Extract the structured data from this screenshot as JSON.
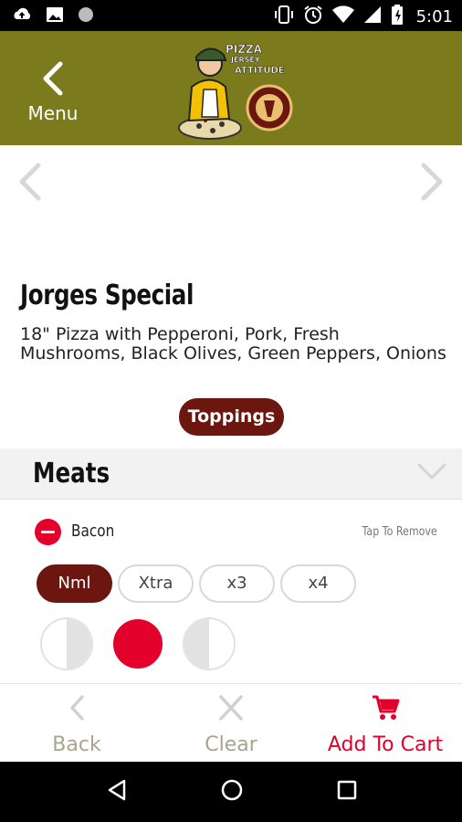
{
  "status_bar": {
    "time": "5:01",
    "left_icons": [
      "cloud-upload-icon",
      "image-icon",
      "circle-icon"
    ],
    "right_icons": [
      "vibrate-icon",
      "alarm-icon",
      "wifi-icon",
      "signal-icon",
      "battery-icon"
    ]
  },
  "header": {
    "back_label": "Menu",
    "background_color": "#7b7a1d",
    "logo": "pizza-chef-logo"
  },
  "item": {
    "title": "Jorges Special",
    "description": "18\" Pizza with Pepperoni, Pork, Fresh Mushrooms, Black Olives, Green Peppers, Onions",
    "toppings_button": "Toppings"
  },
  "section": {
    "title": "Meats"
  },
  "topping": {
    "name": "Bacon",
    "hint": "Tap To Remove",
    "amounts": [
      "Nml",
      "Xtra",
      "x3",
      "x4"
    ],
    "selected_amount": "Nml",
    "coverage_options": [
      "left-half",
      "whole",
      "right-half"
    ],
    "selected_coverage": "whole"
  },
  "bottom_bar": {
    "back_label": "Back",
    "clear_label": "Clear",
    "cart_label": "Add To Cart"
  },
  "colors": {
    "accent_red": "#e3002b",
    "button_brown": "#6b1710",
    "header_olive": "#7b7a1d",
    "muted_label": "#aaa48a"
  }
}
